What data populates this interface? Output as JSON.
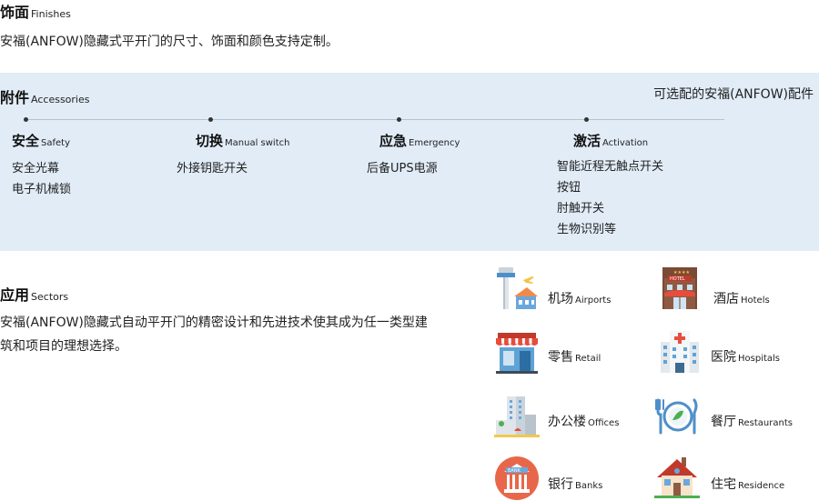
{
  "finishes": {
    "title_cn": "饰面",
    "title_en": "Finishes",
    "description": "安福(ANFOW)隐藏式平开门的尺寸、饰面和颜色支持定制。"
  },
  "accessories": {
    "title_cn": "附件",
    "title_en": "Accessories",
    "optional_note": "可选配的安福(ANFOW)配件",
    "band_color": "#e1ecf7",
    "columns": [
      {
        "title_cn": "安全",
        "title_en": "Safety",
        "items": [
          "安全光幕",
          "电子机械锁"
        ]
      },
      {
        "title_cn": "切换",
        "title_en": "Manual switch",
        "items": [
          "外接钥匙开关"
        ]
      },
      {
        "title_cn": "应急",
        "title_en": "Emergency",
        "items": [
          "后备UPS电源"
        ]
      },
      {
        "title_cn": "激活",
        "title_en": "Activation",
        "items": [
          "智能近程无触点开关",
          "按钮",
          "肘触开关",
          "生物识别等"
        ]
      }
    ]
  },
  "sectors": {
    "title_cn": "应用",
    "title_en": "Sectors",
    "description": "安福(ANFOW)隐藏式自动平开门的精密设计和先进技术使其成为任一类型建筑和项目的理想选择。",
    "items": [
      {
        "cn": "机场",
        "en": "Airports",
        "icon": "airport-icon"
      },
      {
        "cn": "酒店",
        "en": "Hotels",
        "icon": "hotel-icon"
      },
      {
        "cn": "零售",
        "en": "Retail",
        "icon": "retail-store-icon"
      },
      {
        "cn": "医院",
        "en": "Hospitals",
        "icon": "hospital-icon"
      },
      {
        "cn": "办公楼",
        "en": "Offices",
        "icon": "office-building-icon"
      },
      {
        "cn": "餐厅",
        "en": "Restaurants",
        "icon": "restaurant-plate-icon"
      },
      {
        "cn": "银行",
        "en": "Banks",
        "icon": "bank-icon"
      },
      {
        "cn": "住宅",
        "en": "Residence",
        "icon": "house-icon"
      }
    ],
    "bank_sign": "BANK",
    "hotel_sign": "HOTEL"
  }
}
